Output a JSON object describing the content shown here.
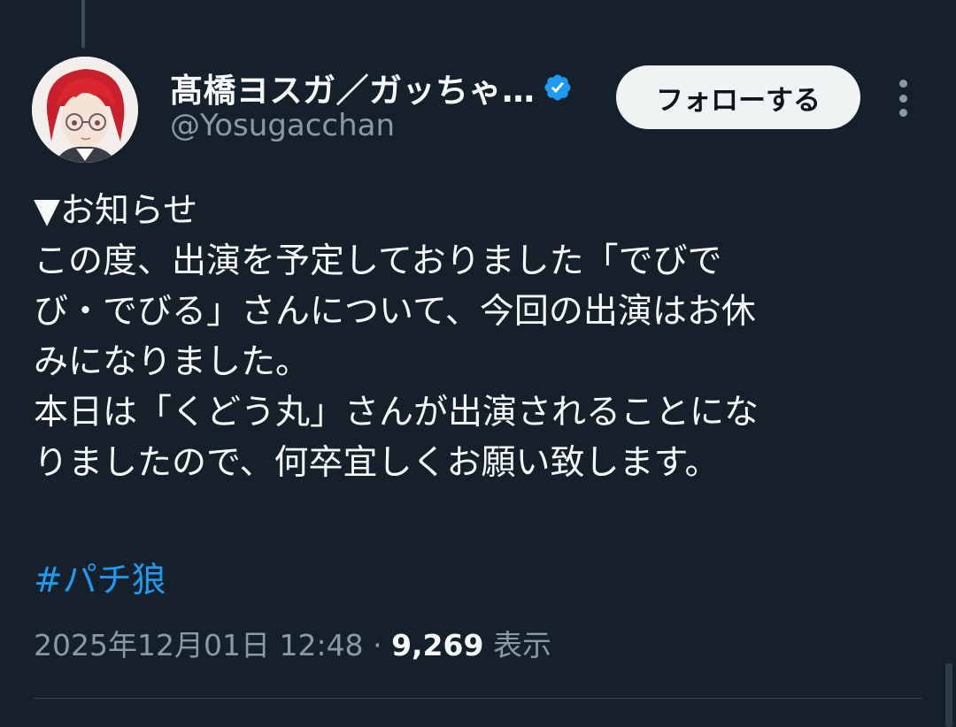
{
  "author": {
    "display_name": "髙橋ヨスガ／ガッちゃ…",
    "handle": "@Yosugacchan",
    "verified": true
  },
  "follow_button_label": "フォローする",
  "tweet": {
    "lines": [
      "▼お知らせ",
      "この度、出演を予定しておりました「でびで",
      "び・でびる」さんについて、今回の出演はお休",
      "みになりました。",
      "本日は「くどう丸」さんが出演されることにな",
      "りましたので、何卒宜しくお願い致します。"
    ],
    "hashtag": "#パチ狼",
    "date": "2025年12月01日 12:48",
    "separator": "·",
    "views_count": "9,269",
    "views_label": "表示"
  },
  "colors": {
    "background": "#15202b",
    "text": "#f7f9f9",
    "secondary_text": "#8b98a5",
    "link": "#1d9bf0",
    "verified_badge": "#1d9bf0",
    "follow_button_bg": "#eff3f4"
  }
}
